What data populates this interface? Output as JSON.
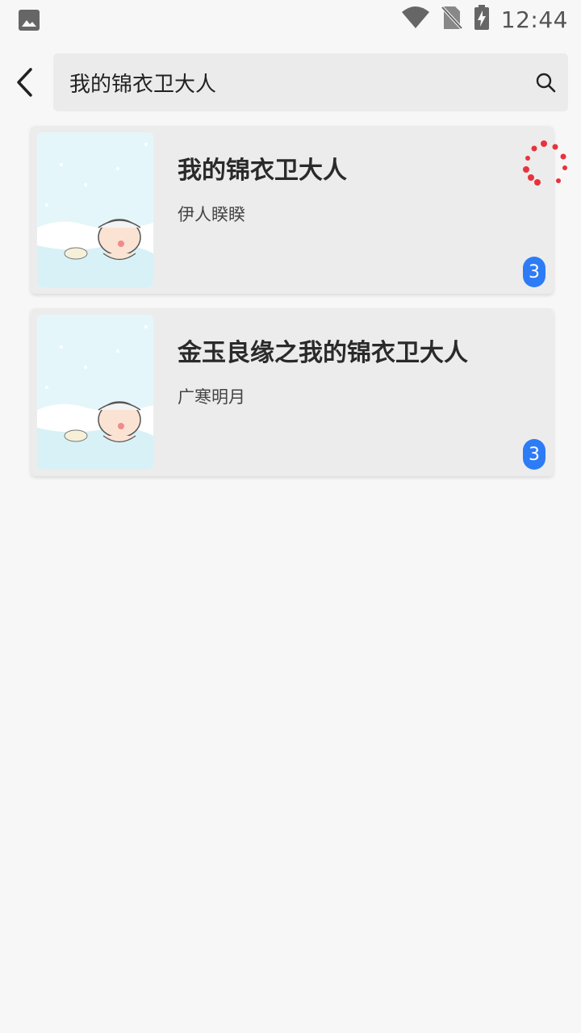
{
  "status_bar": {
    "time": "12:44",
    "icons": [
      "image-icon",
      "wifi-icon",
      "no-sim-icon",
      "battery-charging-icon"
    ]
  },
  "search": {
    "query": "我的锦衣卫大人"
  },
  "results": [
    {
      "title": "我的锦衣卫大人",
      "author": "伊人睽睽",
      "count": "3"
    },
    {
      "title": "金玉良缘之我的锦衣卫大人",
      "author": "广寒明月",
      "count": "3"
    }
  ],
  "colors": {
    "badge": "#2d7cf6",
    "spinner": "#e8323c",
    "background": "#f7f7f7",
    "card": "#ececec"
  }
}
